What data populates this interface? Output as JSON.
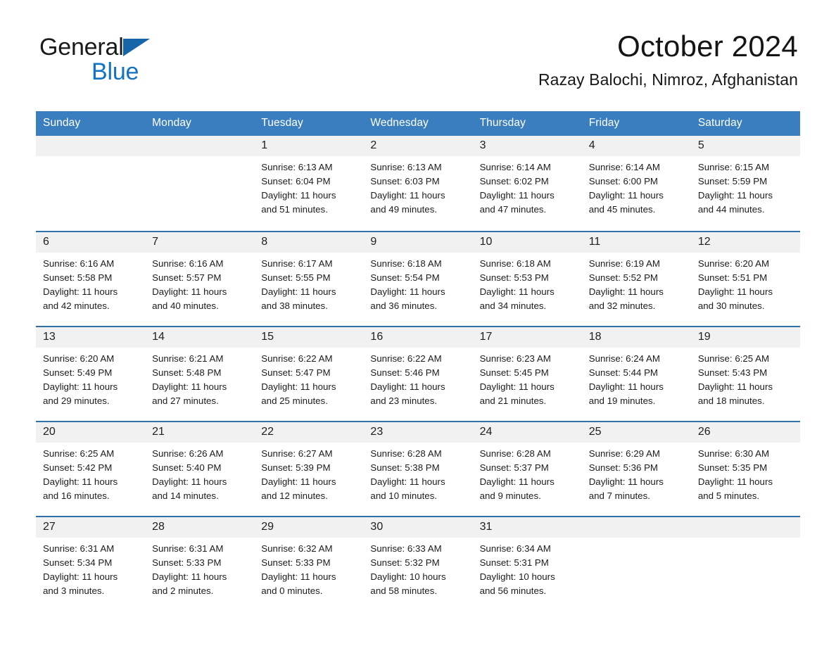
{
  "brand": {
    "name_part1": "General",
    "name_part2": "Blue",
    "triangle_color": "#1565a8",
    "blue_color": "#1272c4"
  },
  "header": {
    "month_title": "October 2024",
    "location": "Razay Balochi, Nimroz, Afghanistan"
  },
  "calendar": {
    "header_background": "#3a7ebf",
    "row_border_color": "#2f6fab",
    "daynum_background": "#f1f1f1",
    "weekday_headers": [
      "Sunday",
      "Monday",
      "Tuesday",
      "Wednesday",
      "Thursday",
      "Friday",
      "Saturday"
    ],
    "weeks": [
      [
        {
          "day": "",
          "sunrise": "",
          "sunset": "",
          "daylight_line1": "",
          "daylight_line2": ""
        },
        {
          "day": "",
          "sunrise": "",
          "sunset": "",
          "daylight_line1": "",
          "daylight_line2": ""
        },
        {
          "day": "1",
          "sunrise": "Sunrise: 6:13 AM",
          "sunset": "Sunset: 6:04 PM",
          "daylight_line1": "Daylight: 11 hours",
          "daylight_line2": "and 51 minutes."
        },
        {
          "day": "2",
          "sunrise": "Sunrise: 6:13 AM",
          "sunset": "Sunset: 6:03 PM",
          "daylight_line1": "Daylight: 11 hours",
          "daylight_line2": "and 49 minutes."
        },
        {
          "day": "3",
          "sunrise": "Sunrise: 6:14 AM",
          "sunset": "Sunset: 6:02 PM",
          "daylight_line1": "Daylight: 11 hours",
          "daylight_line2": "and 47 minutes."
        },
        {
          "day": "4",
          "sunrise": "Sunrise: 6:14 AM",
          "sunset": "Sunset: 6:00 PM",
          "daylight_line1": "Daylight: 11 hours",
          "daylight_line2": "and 45 minutes."
        },
        {
          "day": "5",
          "sunrise": "Sunrise: 6:15 AM",
          "sunset": "Sunset: 5:59 PM",
          "daylight_line1": "Daylight: 11 hours",
          "daylight_line2": "and 44 minutes."
        }
      ],
      [
        {
          "day": "6",
          "sunrise": "Sunrise: 6:16 AM",
          "sunset": "Sunset: 5:58 PM",
          "daylight_line1": "Daylight: 11 hours",
          "daylight_line2": "and 42 minutes."
        },
        {
          "day": "7",
          "sunrise": "Sunrise: 6:16 AM",
          "sunset": "Sunset: 5:57 PM",
          "daylight_line1": "Daylight: 11 hours",
          "daylight_line2": "and 40 minutes."
        },
        {
          "day": "8",
          "sunrise": "Sunrise: 6:17 AM",
          "sunset": "Sunset: 5:55 PM",
          "daylight_line1": "Daylight: 11 hours",
          "daylight_line2": "and 38 minutes."
        },
        {
          "day": "9",
          "sunrise": "Sunrise: 6:18 AM",
          "sunset": "Sunset: 5:54 PM",
          "daylight_line1": "Daylight: 11 hours",
          "daylight_line2": "and 36 minutes."
        },
        {
          "day": "10",
          "sunrise": "Sunrise: 6:18 AM",
          "sunset": "Sunset: 5:53 PM",
          "daylight_line1": "Daylight: 11 hours",
          "daylight_line2": "and 34 minutes."
        },
        {
          "day": "11",
          "sunrise": "Sunrise: 6:19 AM",
          "sunset": "Sunset: 5:52 PM",
          "daylight_line1": "Daylight: 11 hours",
          "daylight_line2": "and 32 minutes."
        },
        {
          "day": "12",
          "sunrise": "Sunrise: 6:20 AM",
          "sunset": "Sunset: 5:51 PM",
          "daylight_line1": "Daylight: 11 hours",
          "daylight_line2": "and 30 minutes."
        }
      ],
      [
        {
          "day": "13",
          "sunrise": "Sunrise: 6:20 AM",
          "sunset": "Sunset: 5:49 PM",
          "daylight_line1": "Daylight: 11 hours",
          "daylight_line2": "and 29 minutes."
        },
        {
          "day": "14",
          "sunrise": "Sunrise: 6:21 AM",
          "sunset": "Sunset: 5:48 PM",
          "daylight_line1": "Daylight: 11 hours",
          "daylight_line2": "and 27 minutes."
        },
        {
          "day": "15",
          "sunrise": "Sunrise: 6:22 AM",
          "sunset": "Sunset: 5:47 PM",
          "daylight_line1": "Daylight: 11 hours",
          "daylight_line2": "and 25 minutes."
        },
        {
          "day": "16",
          "sunrise": "Sunrise: 6:22 AM",
          "sunset": "Sunset: 5:46 PM",
          "daylight_line1": "Daylight: 11 hours",
          "daylight_line2": "and 23 minutes."
        },
        {
          "day": "17",
          "sunrise": "Sunrise: 6:23 AM",
          "sunset": "Sunset: 5:45 PM",
          "daylight_line1": "Daylight: 11 hours",
          "daylight_line2": "and 21 minutes."
        },
        {
          "day": "18",
          "sunrise": "Sunrise: 6:24 AM",
          "sunset": "Sunset: 5:44 PM",
          "daylight_line1": "Daylight: 11 hours",
          "daylight_line2": "and 19 minutes."
        },
        {
          "day": "19",
          "sunrise": "Sunrise: 6:25 AM",
          "sunset": "Sunset: 5:43 PM",
          "daylight_line1": "Daylight: 11 hours",
          "daylight_line2": "and 18 minutes."
        }
      ],
      [
        {
          "day": "20",
          "sunrise": "Sunrise: 6:25 AM",
          "sunset": "Sunset: 5:42 PM",
          "daylight_line1": "Daylight: 11 hours",
          "daylight_line2": "and 16 minutes."
        },
        {
          "day": "21",
          "sunrise": "Sunrise: 6:26 AM",
          "sunset": "Sunset: 5:40 PM",
          "daylight_line1": "Daylight: 11 hours",
          "daylight_line2": "and 14 minutes."
        },
        {
          "day": "22",
          "sunrise": "Sunrise: 6:27 AM",
          "sunset": "Sunset: 5:39 PM",
          "daylight_line1": "Daylight: 11 hours",
          "daylight_line2": "and 12 minutes."
        },
        {
          "day": "23",
          "sunrise": "Sunrise: 6:28 AM",
          "sunset": "Sunset: 5:38 PM",
          "daylight_line1": "Daylight: 11 hours",
          "daylight_line2": "and 10 minutes."
        },
        {
          "day": "24",
          "sunrise": "Sunrise: 6:28 AM",
          "sunset": "Sunset: 5:37 PM",
          "daylight_line1": "Daylight: 11 hours",
          "daylight_line2": "and 9 minutes."
        },
        {
          "day": "25",
          "sunrise": "Sunrise: 6:29 AM",
          "sunset": "Sunset: 5:36 PM",
          "daylight_line1": "Daylight: 11 hours",
          "daylight_line2": "and 7 minutes."
        },
        {
          "day": "26",
          "sunrise": "Sunrise: 6:30 AM",
          "sunset": "Sunset: 5:35 PM",
          "daylight_line1": "Daylight: 11 hours",
          "daylight_line2": "and 5 minutes."
        }
      ],
      [
        {
          "day": "27",
          "sunrise": "Sunrise: 6:31 AM",
          "sunset": "Sunset: 5:34 PM",
          "daylight_line1": "Daylight: 11 hours",
          "daylight_line2": "and 3 minutes."
        },
        {
          "day": "28",
          "sunrise": "Sunrise: 6:31 AM",
          "sunset": "Sunset: 5:33 PM",
          "daylight_line1": "Daylight: 11 hours",
          "daylight_line2": "and 2 minutes."
        },
        {
          "day": "29",
          "sunrise": "Sunrise: 6:32 AM",
          "sunset": "Sunset: 5:33 PM",
          "daylight_line1": "Daylight: 11 hours",
          "daylight_line2": "and 0 minutes."
        },
        {
          "day": "30",
          "sunrise": "Sunrise: 6:33 AM",
          "sunset": "Sunset: 5:32 PM",
          "daylight_line1": "Daylight: 10 hours",
          "daylight_line2": "and 58 minutes."
        },
        {
          "day": "31",
          "sunrise": "Sunrise: 6:34 AM",
          "sunset": "Sunset: 5:31 PM",
          "daylight_line1": "Daylight: 10 hours",
          "daylight_line2": "and 56 minutes."
        },
        {
          "day": "",
          "sunrise": "",
          "sunset": "",
          "daylight_line1": "",
          "daylight_line2": ""
        },
        {
          "day": "",
          "sunrise": "",
          "sunset": "",
          "daylight_line1": "",
          "daylight_line2": ""
        }
      ]
    ]
  }
}
